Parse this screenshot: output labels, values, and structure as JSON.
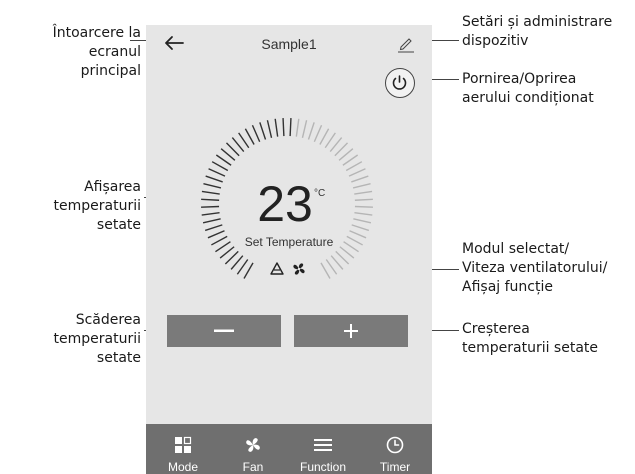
{
  "device": {
    "title": "Sample1",
    "temperature": "23",
    "unit": "°C",
    "set_label": "Set Temperature"
  },
  "tabs": [
    {
      "label": "Mode",
      "icon": "mode-icon"
    },
    {
      "label": "Fan",
      "icon": "fan-icon"
    },
    {
      "label": "Function",
      "icon": "menu-icon"
    },
    {
      "label": "Timer",
      "icon": "clock-icon"
    }
  ],
  "callouts": {
    "back": "Întoarcere la\necranul\nprincipal",
    "settings": "Setări și administrare\ndispozitiv",
    "power": "Pornirea/Oprirea\naerului condiționat",
    "temp_display": "Afișarea\ntemperaturii\nsetate",
    "mode_display": "Modul selectat/\nViteza ventilatorului/\nAfișaj funcție",
    "decrease": "Scăderea\ntemperaturii\nsetate",
    "increase": "Creșterea\ntemperaturii setate"
  },
  "colors": {
    "phone_bg": "#e6e6e6",
    "button_bg": "#7a7a7a",
    "tabbar_bg": "#6f6f6f",
    "tick_active": "#333333",
    "tick_inactive": "#b5b5b5"
  }
}
